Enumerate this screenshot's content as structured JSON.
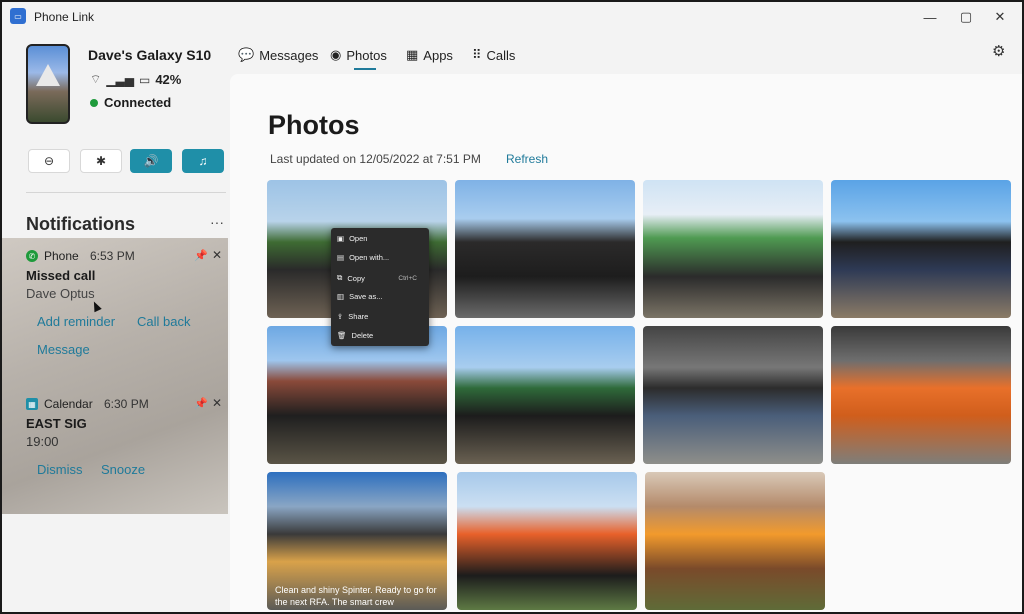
{
  "window": {
    "app_title": "Phone Link",
    "controls": {
      "minimize": "—",
      "maximize": "▢",
      "close": "✕"
    }
  },
  "device": {
    "name": "Dave's Galaxy S10",
    "battery": "42%",
    "status": "Connected",
    "icons": [
      "wifi-icon",
      "signal-icon",
      "battery-icon"
    ]
  },
  "quick_actions": [
    {
      "name": "do-not-disturb",
      "glyph": "⊖",
      "active": false
    },
    {
      "name": "bluetooth",
      "glyph": "✱",
      "active": false
    },
    {
      "name": "volume",
      "glyph": "🔊",
      "active": true
    },
    {
      "name": "media",
      "glyph": "♫",
      "active": true
    }
  ],
  "notifications": {
    "title": "Notifications",
    "more": "···",
    "items": [
      {
        "app": "Phone",
        "time": "6:53 PM",
        "heading": "Missed call",
        "subtitle": "Dave Optus",
        "actions": [
          "Add reminder",
          "Call back",
          "Message"
        ]
      },
      {
        "app": "Calendar",
        "time": "6:30 PM",
        "heading": "EAST SIG",
        "subtitle": "19:00",
        "actions": [
          "Dismiss",
          "Snooze"
        ]
      }
    ]
  },
  "tabs": [
    {
      "label": "Messages",
      "icon": "💬",
      "selected": false
    },
    {
      "label": "Photos",
      "icon": "◉",
      "selected": true
    },
    {
      "label": "Apps",
      "icon": "▦",
      "selected": false
    },
    {
      "label": "Calls",
      "icon": "⠿",
      "selected": false
    }
  ],
  "photos_page": {
    "title": "Photos",
    "last_updated": "Last updated on 12/05/2022 at 7:51 PM",
    "refresh": "Refresh",
    "caption": "Clean and shiny Spinter. Ready to go for the next RFA. The smart crew"
  },
  "context_menu": {
    "items": [
      {
        "label": "Open",
        "icon": "▣",
        "shortcut": ""
      },
      {
        "label": "Open with...",
        "icon": "▤",
        "shortcut": ""
      },
      {
        "label": "Copy",
        "icon": "⧉",
        "shortcut": "Ctrl+C"
      },
      {
        "label": "Save as...",
        "icon": "▥",
        "shortcut": ""
      },
      {
        "label": "Share",
        "icon": "⇪",
        "shortcut": ""
      },
      {
        "label": "Delete",
        "icon": "🗑",
        "shortcut": ""
      }
    ]
  },
  "colors": {
    "accent": "#1f7a9a",
    "toggle_on": "#1f8fa8",
    "connected": "#1e9a3b"
  }
}
